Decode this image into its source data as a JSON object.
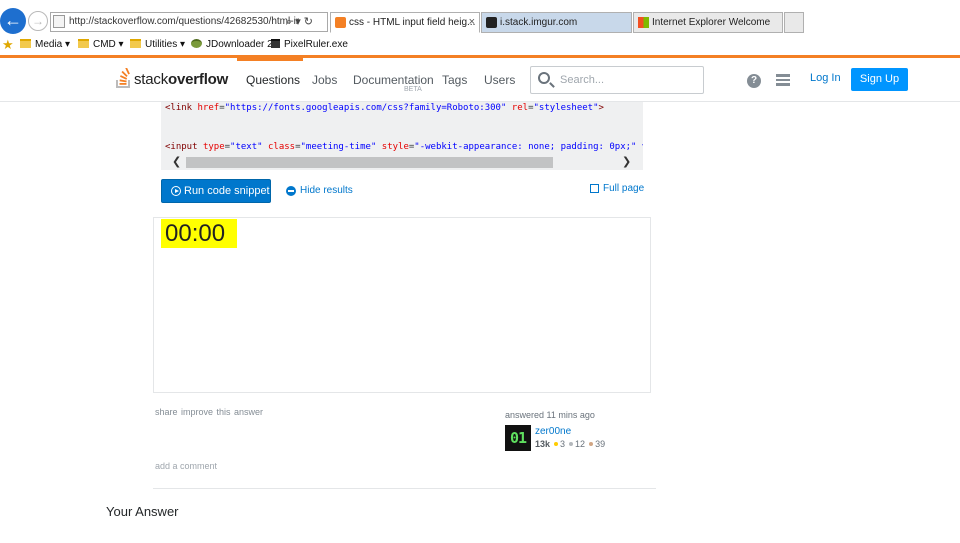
{
  "browser": {
    "address_url": "http://stackoverflow.com/questions/42682530/html-ir",
    "address_tools": "⌕ ▾ ↻",
    "tabs": [
      {
        "label": "css - HTML input field heig...",
        "close": "×"
      },
      {
        "label": "i.stack.imgur.com"
      },
      {
        "label": "Internet Explorer Welcome"
      }
    ],
    "favorites": [
      {
        "label": "Media ▾"
      },
      {
        "label": "CMD ▾"
      },
      {
        "label": "Utilities ▾"
      },
      {
        "label": "JDownloader 2"
      },
      {
        "label": "PixelRuler.exe"
      }
    ]
  },
  "header": {
    "logo_light": "stack",
    "logo_bold": "overflow",
    "nav": {
      "questions": "Questions",
      "jobs": "Jobs",
      "documentation": "Documentation",
      "beta": "BETA",
      "tags": "Tags",
      "users": "Users"
    },
    "search_placeholder": "Search...",
    "help_icon": "?",
    "login": "Log In",
    "signup": "Sign Up"
  },
  "snippet": {
    "line1": {
      "open": "<link ",
      "attr1": "href",
      "eq1": "=",
      "val1": "\"https://fonts.googleapis.com/css?family=Roboto:300\"",
      "attr2": " rel",
      "eq2": "=",
      "val2": "\"stylesheet\"",
      "close": ">"
    },
    "line2": {
      "open": "<input ",
      "attr1": "type",
      "eq1": "=",
      "val1": "\"text\"",
      "attr2": " class",
      "eq2": "=",
      "val2": "\"meeting-time\"",
      "attr3": " style",
      "eq3": "=",
      "val3": "\"-webkit-appearance: none; padding: 0px;\" v"
    },
    "run_label": "Run code snippet",
    "hide_label": "Hide results",
    "full_page_label": "Full page",
    "result_value": "00:00"
  },
  "post": {
    "menu": "share  improve this answer",
    "answered": "answered 11 mins ago",
    "avatar_text": "01",
    "user_name": "zer00ne",
    "rep": "13k",
    "gold": "3",
    "silver": "12",
    "bronze": "39",
    "add_comment": "add a comment"
  },
  "your_answer": "Your Answer",
  "colors": {
    "accent": "#f48024",
    "link": "#0077cc",
    "signup": "#0095ff",
    "result_highlight": "#ffff00"
  }
}
